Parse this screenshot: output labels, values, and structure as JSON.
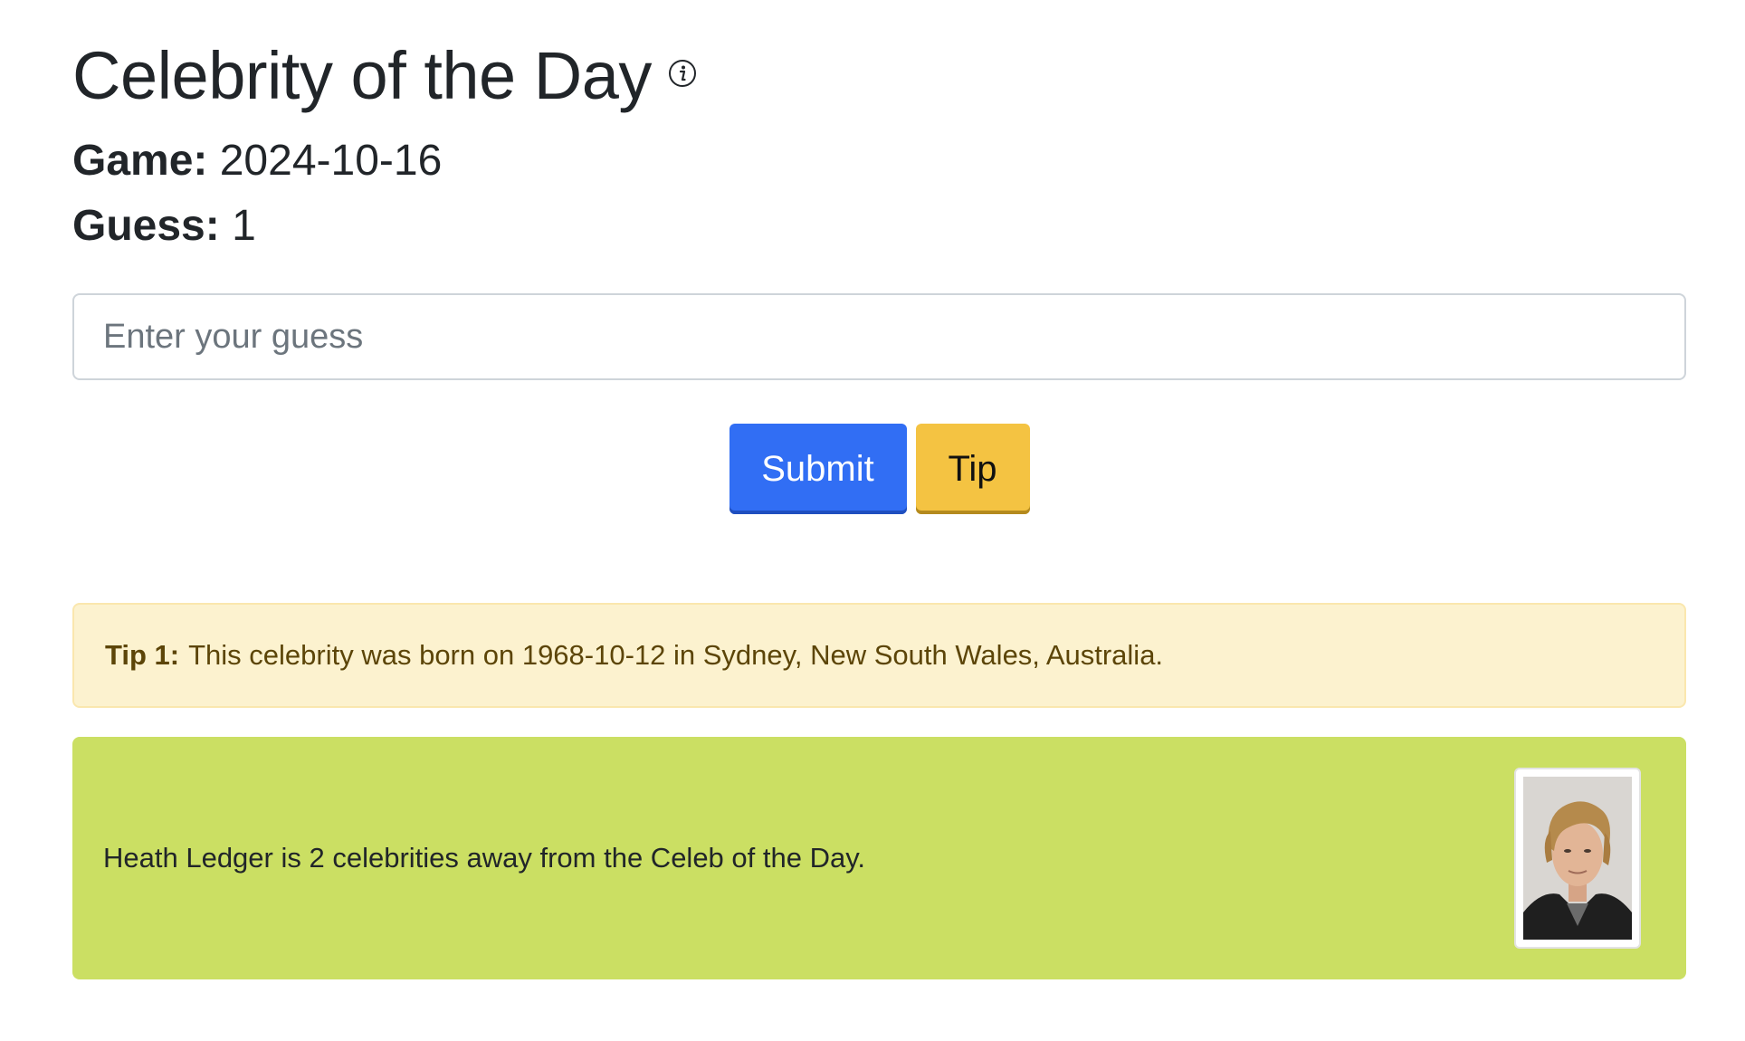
{
  "header": {
    "title": "Celebrity of the Day",
    "info_icon": "info-circle-icon"
  },
  "game": {
    "label": "Game:",
    "value": "2024-10-16"
  },
  "guess": {
    "label": "Guess:",
    "value": "1"
  },
  "input": {
    "placeholder": "Enter your guess",
    "value": ""
  },
  "buttons": {
    "submit_label": "Submit",
    "tip_label": "Tip"
  },
  "tip_alert": {
    "label": "Tip 1:",
    "text": "This celebrity was born on 1968-10-12 in Sydney, New South Wales, Australia."
  },
  "result": {
    "text": "Heath Ledger is 2 celebrities away from the Celeb of the Day.",
    "photo_alt": "Heath Ledger"
  },
  "colors": {
    "submit": "#316ef4",
    "tip": "#f4c342",
    "tip_alert_bg": "#fcf2cf",
    "result_bg": "#cbdf63"
  }
}
